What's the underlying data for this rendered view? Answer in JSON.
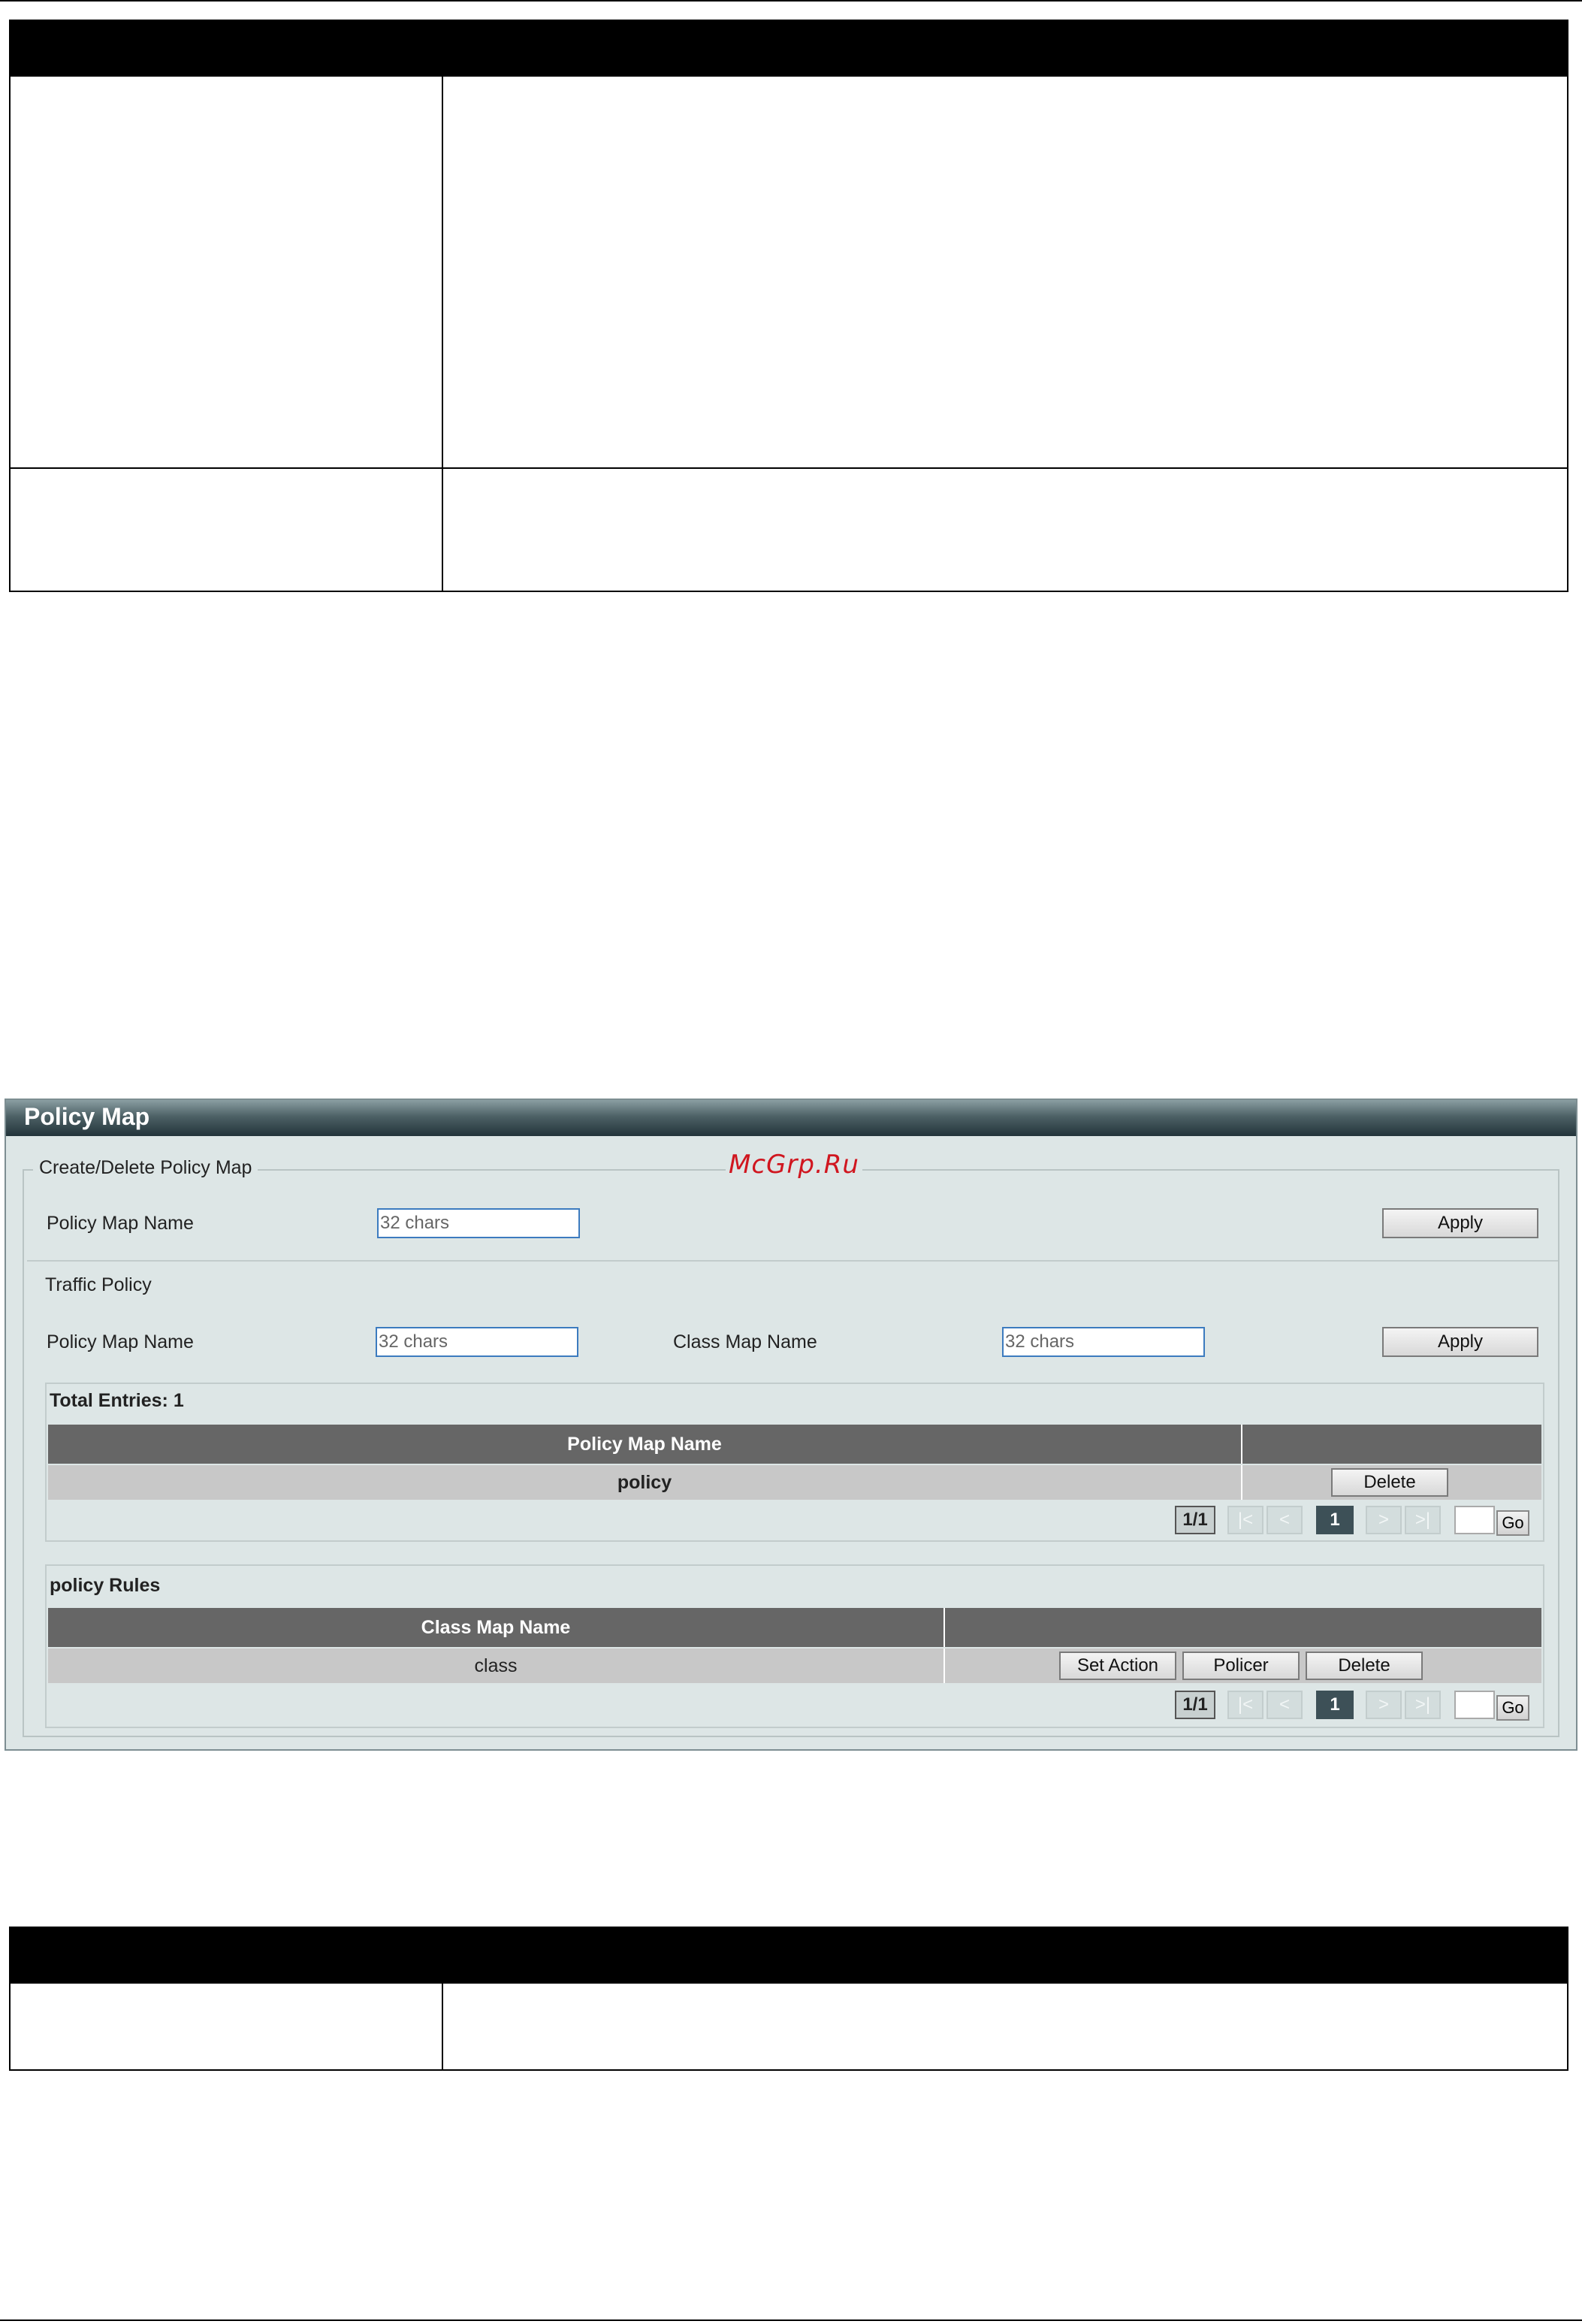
{
  "watermark": "McGrp.Ru",
  "panel": {
    "title": "Policy Map",
    "create_delete": {
      "legend": "Create/Delete Policy Map",
      "policy_map_name_label": "Policy Map Name",
      "policy_map_name_placeholder": "32 chars",
      "apply_label": "Apply"
    },
    "traffic_policy": {
      "heading": "Traffic Policy",
      "policy_map_name_label": "Policy Map Name",
      "policy_map_name_placeholder": "32 chars",
      "class_map_name_label": "Class Map Name",
      "class_map_name_placeholder": "32 chars",
      "apply_label": "Apply"
    },
    "policy_table": {
      "total_entries": "Total Entries: 1",
      "columns": [
        "Policy Map Name",
        ""
      ],
      "rows": [
        {
          "name": "policy",
          "delete_label": "Delete"
        }
      ],
      "pagination": {
        "count": "1/1",
        "first": "|<",
        "prev": "<",
        "current": "1",
        "next": ">",
        "last": ">|",
        "go_label": "Go"
      }
    },
    "rules_table": {
      "heading": "policy Rules",
      "columns": [
        "Class Map Name",
        ""
      ],
      "rows": [
        {
          "name": "class",
          "set_action_label": "Set Action",
          "policer_label": "Policer",
          "delete_label": "Delete"
        }
      ],
      "pagination": {
        "count": "1/1",
        "first": "|<",
        "prev": "<",
        "current": "1",
        "next": ">",
        "last": ">|",
        "go_label": "Go"
      }
    }
  }
}
